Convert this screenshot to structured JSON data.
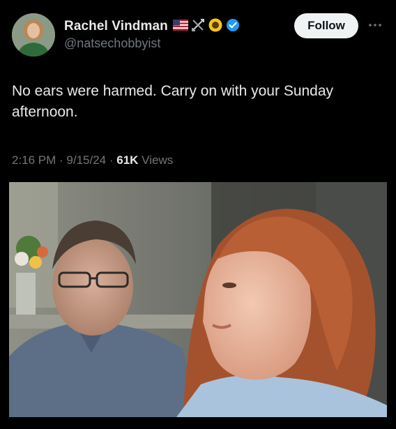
{
  "tweet": {
    "author": {
      "display_name": "Rachel Vindman",
      "handle": "@natsechobbyist",
      "badges": [
        "us-flag-icon",
        "crossed-arrows-icon",
        "sunflower-icon",
        "verified-badge-icon"
      ],
      "verified_color": "#1d9bf0"
    },
    "follow_label": "Follow",
    "more_icon": "more-icon",
    "text": "No ears were harmed. Carry on with your Sunday afternoon.",
    "meta": {
      "time": "2:16 PM",
      "separator": " · ",
      "date": "9/15/24",
      "views_count": "61K",
      "views_label": " Views"
    },
    "media": {
      "type": "photo"
    }
  },
  "colors": {
    "background": "#000000",
    "primary_text": "#e7e9ea",
    "secondary_text": "#71767b",
    "follow_button_bg": "#eff3f4"
  }
}
